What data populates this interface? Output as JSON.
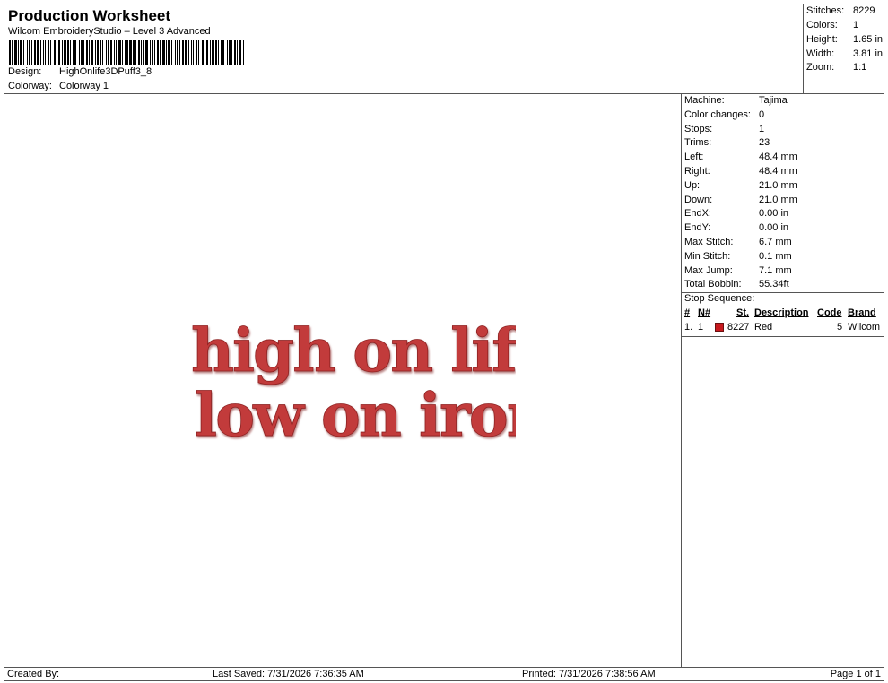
{
  "header": {
    "title": "Production Worksheet",
    "software": "Wilcom EmbroideryStudio – Level 3 Advanced",
    "design_label": "Design:",
    "design_value": "HighOnlife3DPuff3_8",
    "colorway_label": "Colorway:",
    "colorway_value": "Colorway 1"
  },
  "summary": {
    "stitches_label": "Stitches:",
    "stitches_value": "8229",
    "colors_label": "Colors:",
    "colors_value": "1",
    "height_label": "Height:",
    "height_value": "1.65 in",
    "width_label": "Width:",
    "width_value": "3.81 in",
    "zoom_label": "Zoom:",
    "zoom_value": "1:1"
  },
  "design": {
    "line1": "high on life,",
    "line2": "low on iron",
    "thread_color": "#c23a3a"
  },
  "info": {
    "machine_label": "Machine:",
    "machine_value": "Tajima",
    "color_changes_label": "Color changes:",
    "color_changes_value": "0",
    "stops_label": "Stops:",
    "stops_value": "1",
    "trims_label": "Trims:",
    "trims_value": "23",
    "left_label": "Left:",
    "left_value": "48.4 mm",
    "right_label": "Right:",
    "right_value": "48.4 mm",
    "up_label": "Up:",
    "up_value": "21.0 mm",
    "down_label": "Down:",
    "down_value": "21.0 mm",
    "endx_label": "EndX:",
    "endx_value": "0.00 in",
    "endy_label": "EndY:",
    "endy_value": "0.00 in",
    "max_stitch_label": "Max Stitch:",
    "max_stitch_value": "6.7 mm",
    "min_stitch_label": "Min Stitch:",
    "min_stitch_value": "0.1 mm",
    "max_jump_label": "Max Jump:",
    "max_jump_value": "7.1 mm",
    "total_bobbin_label": "Total Bobbin:",
    "total_bobbin_value": "55.34ft"
  },
  "stop_sequence": {
    "title": "Stop Sequence:",
    "columns": {
      "num": "#",
      "n": "N#",
      "st": "St.",
      "description": "Description",
      "code": "Code",
      "brand": "Brand"
    },
    "rows": [
      {
        "num": "1.",
        "n": "1",
        "swatch_color": "#c8191e",
        "st": "8227",
        "description": "Red",
        "code": "5",
        "brand": "Wilcom"
      }
    ]
  },
  "footer": {
    "created_by": "Created By:",
    "last_saved": "Last Saved: 7/31/2026 7:36:35 AM",
    "printed": "Printed: 7/31/2026 7:38:56 AM",
    "page": "Page 1 of 1"
  }
}
